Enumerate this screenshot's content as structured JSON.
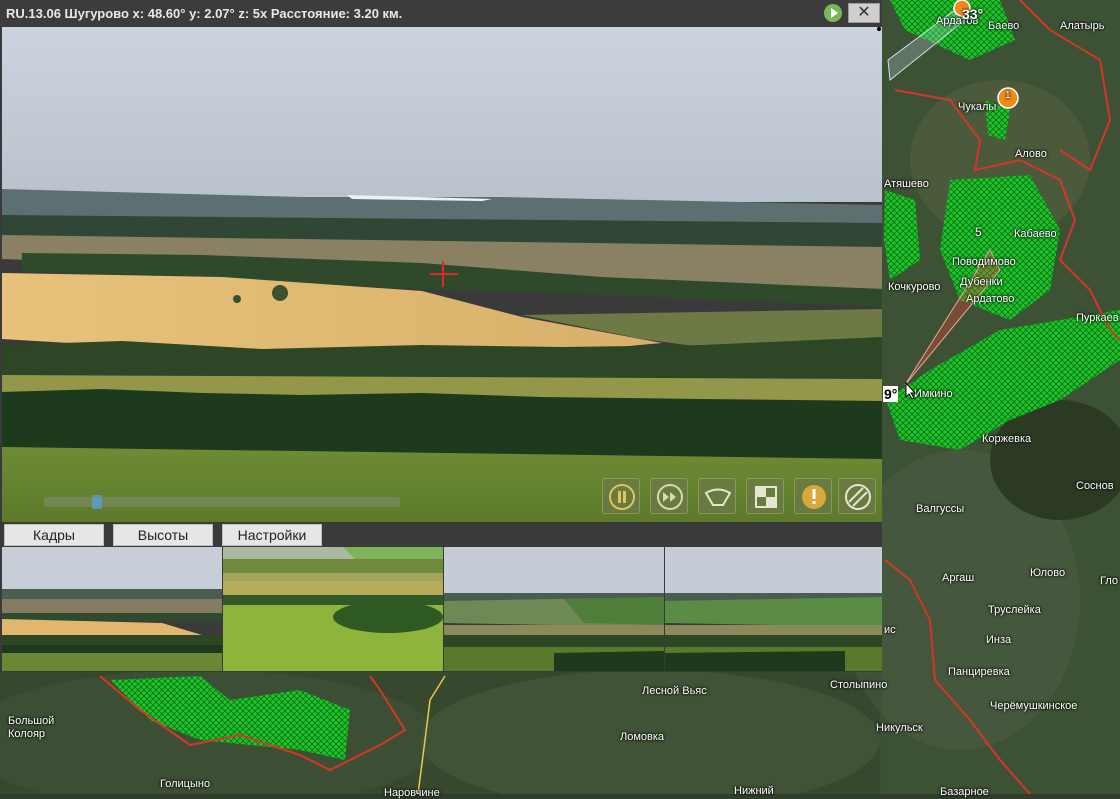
{
  "window": {
    "title": "RU.13.06 Шугурово x: 48.60° y: 2.07° z: 5x Расстояние: 3.20 км.",
    "close_label": "✕"
  },
  "tabs": [
    {
      "label": "Кадры"
    },
    {
      "label": "Высоты"
    },
    {
      "label": "Настройки"
    }
  ],
  "map": {
    "labels": [
      {
        "text": "Ардатов"
      },
      {
        "text": "Баево"
      },
      {
        "text": "Алатырь"
      },
      {
        "text": "Чукалы"
      },
      {
        "text": "Алово"
      },
      {
        "text": "Атяшево"
      },
      {
        "text": "Кабаево"
      },
      {
        "text": "Поводимово"
      },
      {
        "text": "Дубенки"
      },
      {
        "text": "Кочкурово"
      },
      {
        "text": "Ардатово"
      },
      {
        "text": "Пуркаев"
      },
      {
        "text": "Имкино"
      },
      {
        "text": "Коржевка"
      },
      {
        "text": "Соснов"
      },
      {
        "text": "Валгуссы"
      },
      {
        "text": "Аргаш"
      },
      {
        "text": "Юлово"
      },
      {
        "text": "Гло"
      },
      {
        "text": "Труслейка"
      },
      {
        "text": "Инза"
      },
      {
        "text": "Панциревка"
      },
      {
        "text": "Черёмушкинское"
      },
      {
        "text": "Никульск"
      },
      {
        "text": "Столыпино"
      },
      {
        "text": "Лесной Вьяс"
      },
      {
        "text": "Ломовка"
      },
      {
        "text": "Большой Колояр"
      },
      {
        "text": "Голицыно"
      },
      {
        "text": "Нижний"
      },
      {
        "text": "Наровчине"
      },
      {
        "text": "Базарное"
      },
      {
        "text": "ис"
      }
    ],
    "sector_angle_top": "33°",
    "sector_angle_left": "9°",
    "cluster_count": "1",
    "zone_number": "5"
  },
  "colors": {
    "forest_zone": "#1fd12c",
    "boundary": "#d8352a",
    "marker": "#f08a1a",
    "crosshair": "#e0262a"
  },
  "toolbar_icons": [
    "pause-icon",
    "fast-forward-icon",
    "fov-icon",
    "frame-icon",
    "alert-icon",
    "pattern-icon"
  ]
}
